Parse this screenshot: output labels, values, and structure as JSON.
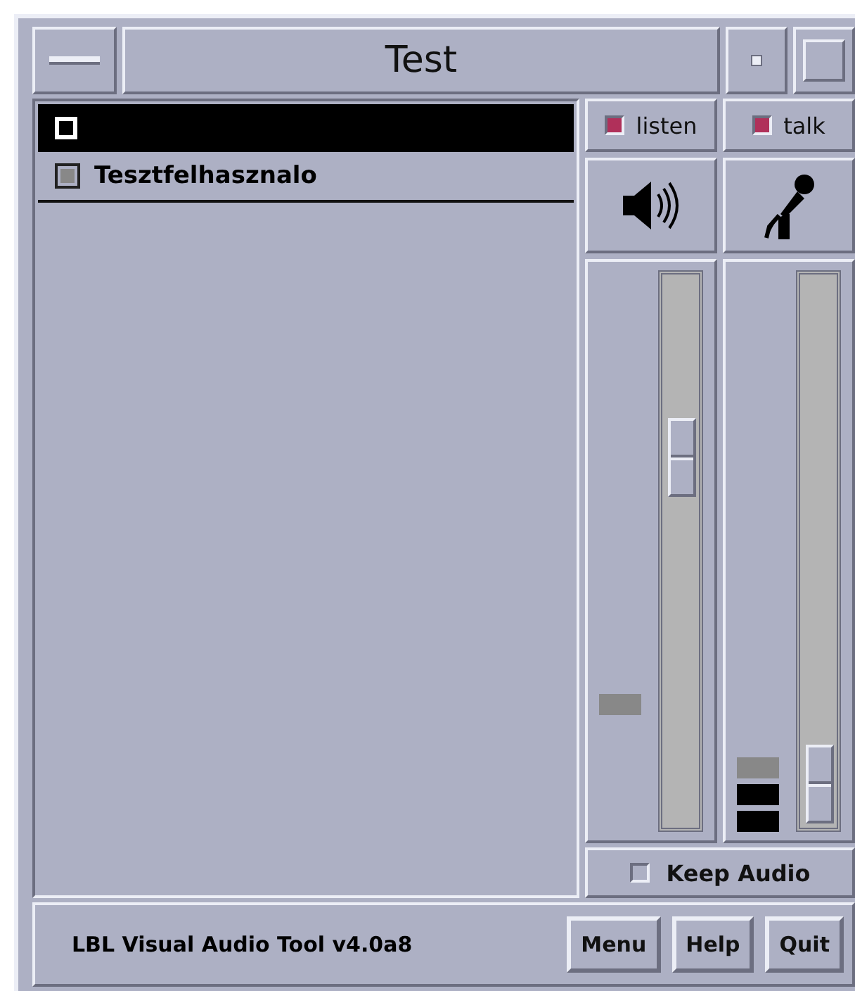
{
  "window": {
    "title": "Test"
  },
  "participants": [
    {
      "name": "Tesztfelhasznalo"
    }
  ],
  "listen": {
    "label": "listen",
    "checked": true
  },
  "talk": {
    "label": "talk",
    "checked": true
  },
  "keep_audio": {
    "label": "Keep Audio",
    "checked": false
  },
  "status": "LBL Visual Audio Tool v4.0a8",
  "buttons": [
    "Menu",
    "Help",
    "Quit"
  ]
}
